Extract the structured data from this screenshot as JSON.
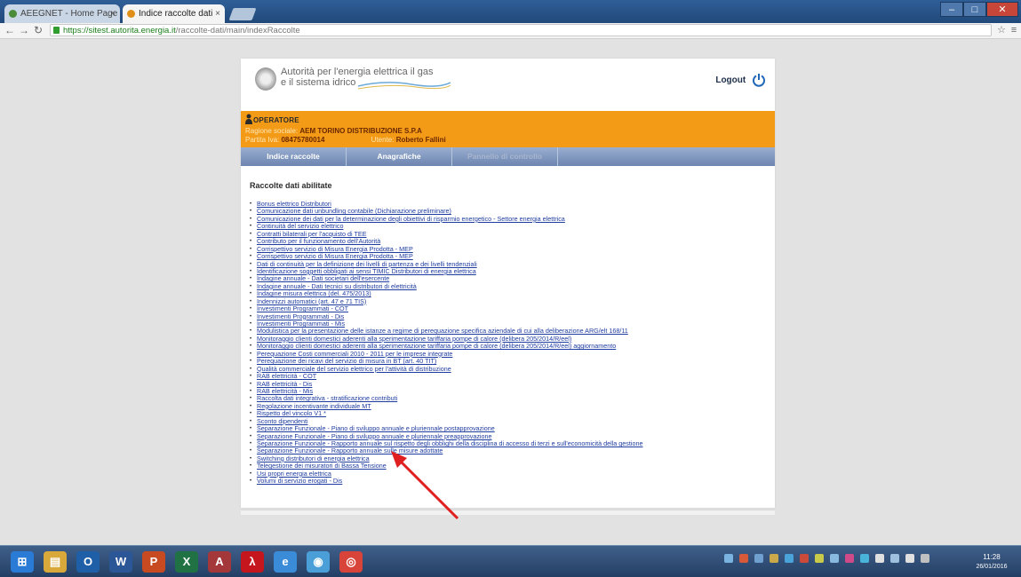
{
  "browser": {
    "tabs": [
      {
        "label": "AEEGNET - Home Page",
        "active": false
      },
      {
        "label": "Indice raccolte dati",
        "active": true
      }
    ],
    "address": {
      "secure_part": "https://sitest.autorita.energia.it",
      "path_part": "/raccolte-dati/main/indexRaccolte"
    },
    "window_controls": {
      "minimize": "–",
      "maximize": "□",
      "close": "✕"
    }
  },
  "header": {
    "logo_line1": "Autorità per l'energia elettrica il gas",
    "logo_line2": "e il sistema idrico",
    "logout_label": "Logout"
  },
  "operator": {
    "title": "OPERATORE",
    "ragione_sociale_label": "Ragione sociale:",
    "ragione_sociale_value": "AEM TORINO DISTRIBUZIONE S.P.A",
    "partita_iva_label": "Partita Iva:",
    "partita_iva_value": "08475780014",
    "utente_label": "Utente:",
    "utente_value": "Roberto Fallini"
  },
  "nav": {
    "tabs": [
      {
        "label": "Indice raccolte",
        "enabled": true
      },
      {
        "label": "Anagrafiche",
        "enabled": true
      },
      {
        "label": "Pannello di controllo",
        "enabled": false
      }
    ]
  },
  "list": {
    "heading": "Raccolte dati abilitate",
    "items": [
      "Bonus elettrico Distributori",
      "Comunicazione dati unbundling contabile (Dichiarazione preliminare)",
      "Comunicazione dei dati per la determinazione degli obiettivi di risparmio energetico - Settore energia elettrica",
      "Continuità del servizio elettrico",
      "Contratti bilaterali per l'acquisto di TEE",
      "Contributo per il funzionamento dell'Autorità",
      "Corrispettivo servizio di Misura Energia Prodotta - MEP",
      "Corrispettivo servizio di Misura Energia Prodotta - MEP",
      "Dati di continuità per la definizione dei livelli di partenza e dei livelli tendenziali",
      "Identificazione soggetti obbligati ai sensi TIMIC Distributori di energia elettrica",
      "Indagine annuale - Dati societari dell'esercente",
      "Indagine annuale - Dati tecnici su distributori di elettricità",
      "Indagine misura elettrica (del. 475/2013)",
      "Indennizzi automatici (art. 47 e 71 TIS)",
      "Investimenti Programmati - COT",
      "Investimenti Programmati - Dis",
      "Investimenti Programmati - Mis",
      "Modulistica per la presentazione delle istanze a regime di perequazione specifica aziendale di cui alla deliberazione ARG/elt 168/11",
      "Monitoraggio clienti domestici aderenti alla sperimentazione tariffaria pompe di calore (delibera 205/2014/R/eel)",
      "Monitoraggio clienti domestici aderenti alla sperimentazione tariffaria pompe di calore (delibera 205/2014/R/eel) aggiornamento",
      "Perequazione Costi commerciali 2010 - 2011 per le imprese integrate",
      "Perequazione dei ricavi del servizio di misura in BT (art. 40 TIT)",
      "Qualità commerciale del servizio elettrico per l'attività di distribuzione",
      "RAB elettricità - COT",
      "RAB elettricità - Dis",
      "RAB elettricità - Mis",
      "Raccolta dati integrativa - stratificazione contributi",
      "Regolazione incentivante individuale MT",
      "Rispetto del vincolo V1 *",
      "Sconto dipendenti",
      "Separazione Funzionale - Piano di sviluppo annuale e pluriennale postapprovazione",
      "Separazione Funzionale - Piano di sviluppo annuale e pluriennale preapprovazione",
      "Separazione Funzionale - Rapporto annuale sul rispetto degli obblighi della disciplina di accesso di terzi e sull'economicità della gestione",
      "Separazione Funzionale - Rapporto annuale sulle misure adottate",
      "Switching distributori di energia elettrica",
      "Telegestione dei misuratori di Bassa Tensione",
      "Usi propri energia elettrica",
      "Volumi di servizio erogati - Dis"
    ]
  },
  "taskbar": {
    "apps": [
      {
        "name": "start",
        "glyph": "⊞",
        "color": "#2a7bd6"
      },
      {
        "name": "explorer",
        "glyph": "▤",
        "color": "#d9a83a"
      },
      {
        "name": "outlook",
        "glyph": "O",
        "color": "#1e5fa8"
      },
      {
        "name": "word",
        "glyph": "W",
        "color": "#2b5797"
      },
      {
        "name": "powerpoint",
        "glyph": "P",
        "color": "#c74a21"
      },
      {
        "name": "excel",
        "glyph": "X",
        "color": "#207245"
      },
      {
        "name": "access",
        "glyph": "A",
        "color": "#a4373a"
      },
      {
        "name": "acrobat",
        "glyph": "λ",
        "color": "#c4161c"
      },
      {
        "name": "internet-explorer",
        "glyph": "e",
        "color": "#3a8bd8"
      },
      {
        "name": "app",
        "glyph": "◉",
        "color": "#4a9fd9"
      },
      {
        "name": "chrome",
        "glyph": "◎",
        "color": "#d8443a"
      }
    ],
    "clock_time": "11:28",
    "clock_date": "26/01/2016"
  }
}
